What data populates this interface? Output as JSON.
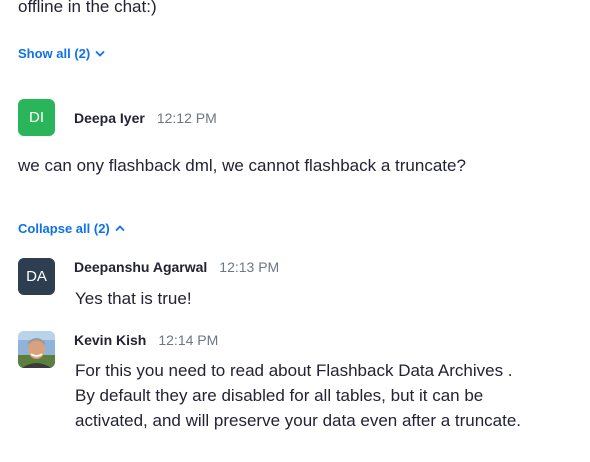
{
  "thread_top": {
    "partial_message": "offline in the chat:)",
    "show_all_label": "Show all (2)"
  },
  "messages": [
    {
      "initials": "DI",
      "avatar_color": "#2bb55a",
      "sender": "Deepa Iyer",
      "time": "12:12 PM",
      "text": "we can ony flashback dml, we cannot flashback a truncate?"
    }
  ],
  "replies": {
    "collapse_label": "Collapse all (2)",
    "items": [
      {
        "initials": "DA",
        "avatar_color": "#2c3e50",
        "sender": "Deepanshu Agarwal",
        "time": "12:13 PM",
        "text": "Yes that is true!"
      },
      {
        "avatar": "photo",
        "sender": "Kevin Kish",
        "time": "12:14 PM",
        "lines": [
          "For this you need to read about Flashback Data Archives .",
          "By default they are disabled for all tables, but it can be",
          "activated, and will preserve your data even after a truncate."
        ]
      }
    ]
  },
  "colors": {
    "link": "#0e71eb",
    "text": "#232333",
    "timestamp": "#6e7680"
  }
}
